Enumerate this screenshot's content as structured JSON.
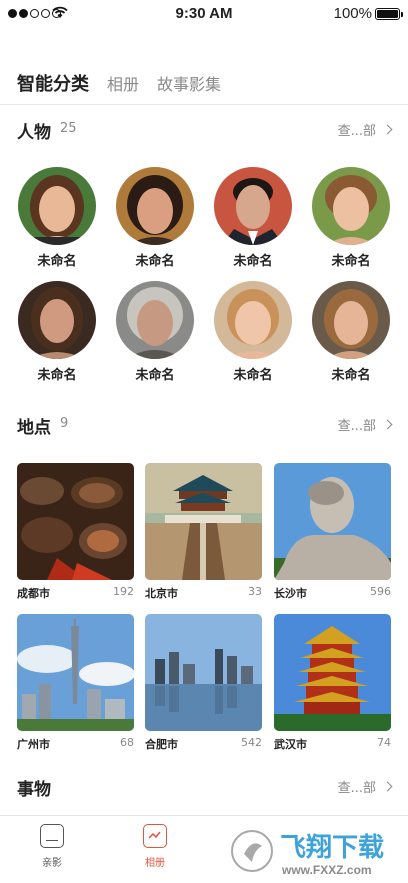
{
  "status_bar": {
    "time": "9:30 AM",
    "battery": "100%"
  },
  "tabs": [
    {
      "label": "智能分类",
      "active": true
    },
    {
      "label": "相册",
      "active": false
    },
    {
      "label": "故事影集",
      "active": false
    }
  ],
  "people": {
    "title": "人物",
    "count": "25",
    "see_all": "查...部",
    "items": [
      {
        "name": "未命名"
      },
      {
        "name": "未命名"
      },
      {
        "name": "未命名"
      },
      {
        "name": "未命名"
      },
      {
        "name": "未命名"
      },
      {
        "name": "未命名"
      },
      {
        "name": "未命名"
      },
      {
        "name": "未命名"
      }
    ]
  },
  "places": {
    "title": "地点",
    "count": "9",
    "see_all": "查...部",
    "items": [
      {
        "name": "成都市",
        "count": "192"
      },
      {
        "name": "北京市",
        "count": "33"
      },
      {
        "name": "长沙市",
        "count": "596"
      },
      {
        "name": "广州市",
        "count": "68"
      },
      {
        "name": "合肥市",
        "count": "542"
      },
      {
        "name": "武汉市",
        "count": "74"
      }
    ]
  },
  "things": {
    "title": "事物",
    "see_all": "查...部"
  },
  "bottom_nav": [
    {
      "label": "亲影",
      "icon": "home-icon",
      "active": false
    },
    {
      "label": "相册",
      "icon": "album-icon",
      "active": true
    }
  ],
  "watermark": {
    "text": "飞翔下载",
    "url": "www.FXXZ.com"
  }
}
